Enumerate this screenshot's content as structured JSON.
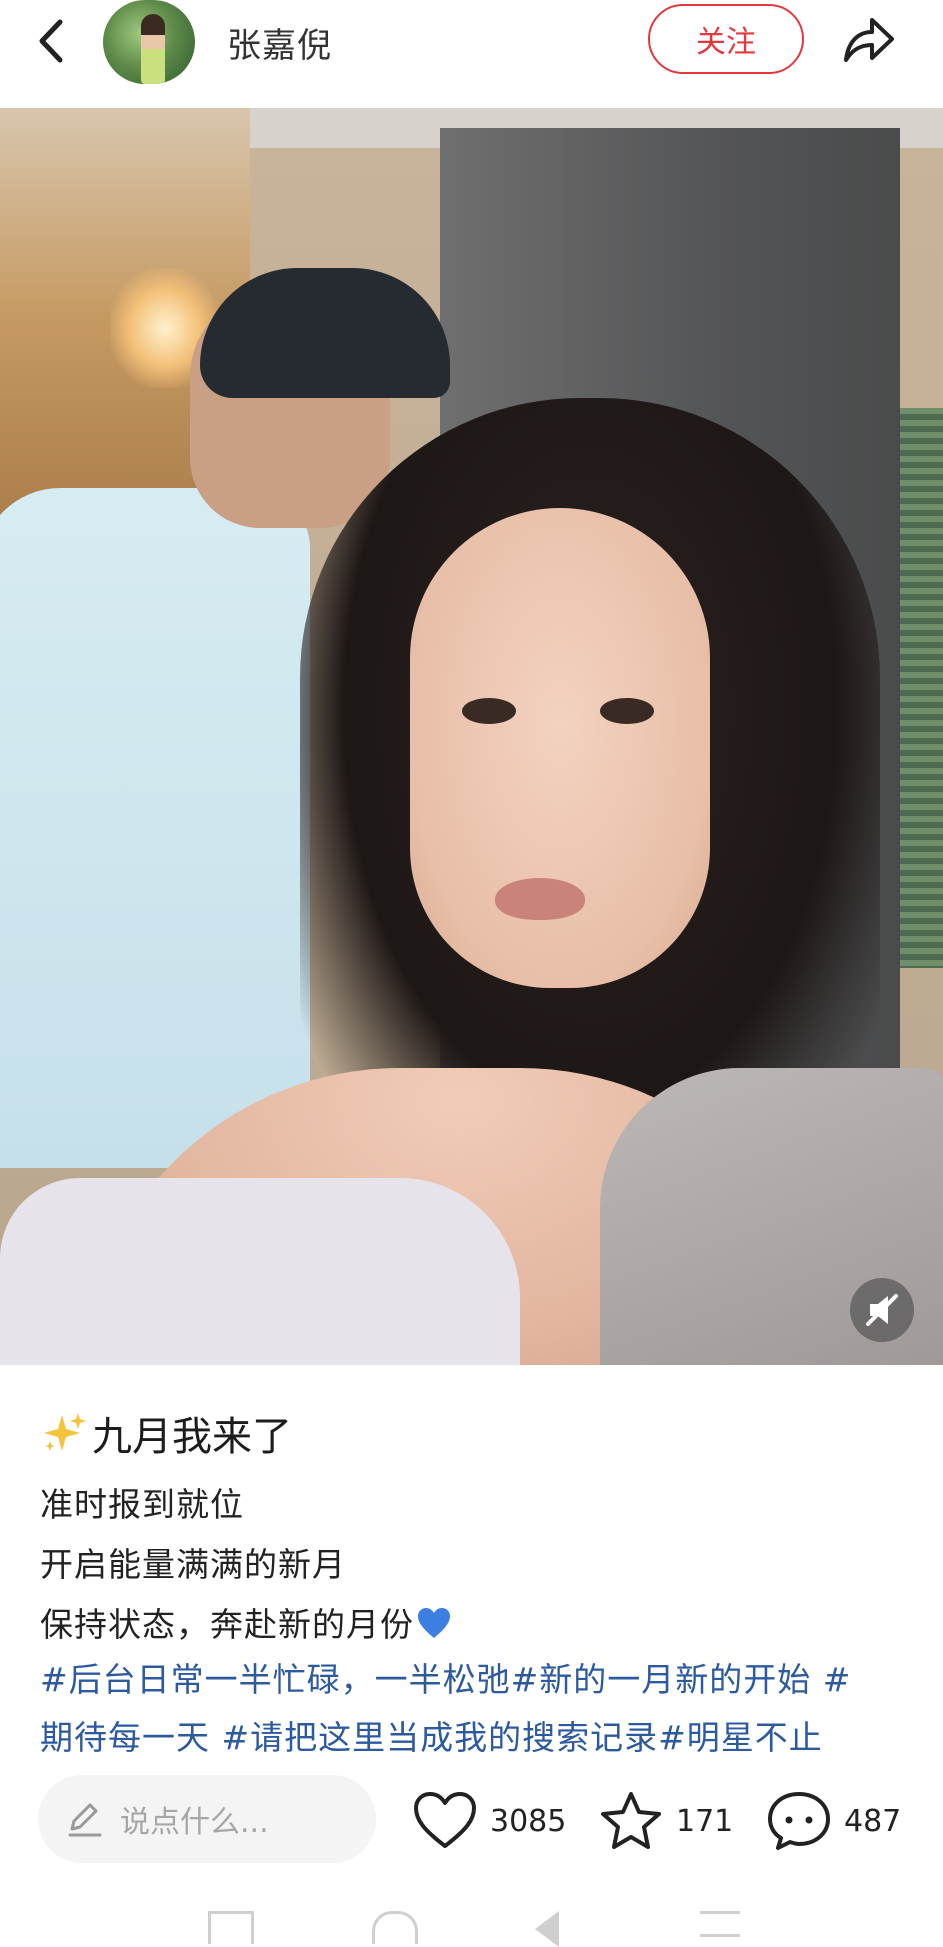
{
  "header": {
    "username": "张嘉倪",
    "follow_label": "关注"
  },
  "post": {
    "title": "九月我来了",
    "lines": [
      "准时报到就位",
      "开启能量满满的新月",
      "保持状态，奔赴新的月份"
    ],
    "tags": [
      "#后台日常一半忙碌，一半松弛",
      "#新的一月新的开始 #",
      "期待每一天",
      "#请把这里当成我的搜索记录",
      "#明星不止"
    ]
  },
  "comment": {
    "placeholder": "说点什么..."
  },
  "actions": {
    "likes": "3085",
    "favorites": "171",
    "comments": "487"
  },
  "icons": {
    "back": "chevron-left-icon",
    "share": "share-arrow-icon",
    "sound": "speaker-muted-icon",
    "sparkle": "sparkles-emoji",
    "blue_heart": "blue-heart-emoji",
    "pen": "pen-icon",
    "like": "heart-outline-icon",
    "favorite": "star-outline-icon",
    "comment": "chat-bubble-icon"
  },
  "colors": {
    "accent": "#e4383e",
    "tag": "#2d5a9e"
  }
}
